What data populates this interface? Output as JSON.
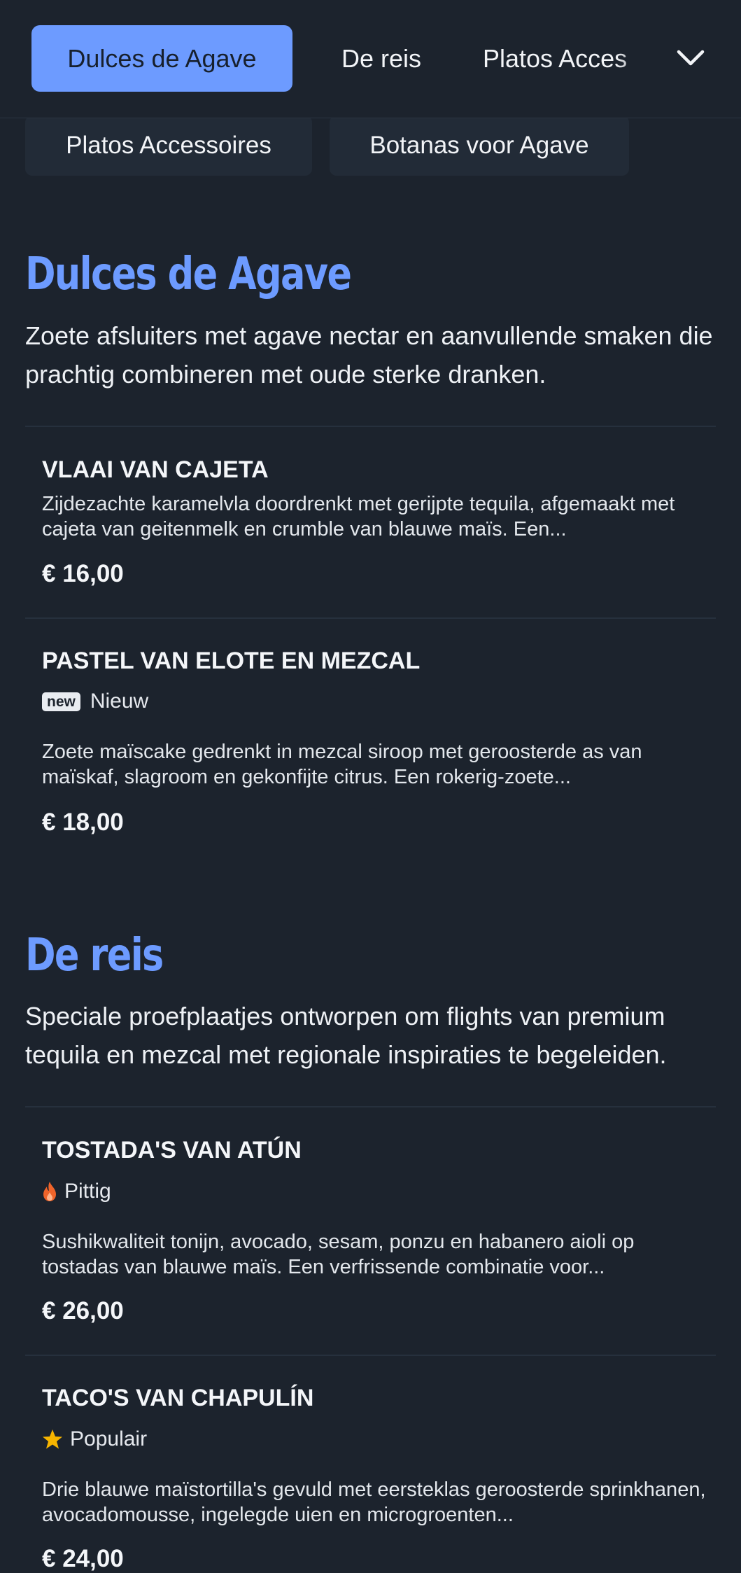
{
  "nav": {
    "tabs": [
      {
        "label": "Dulces de Agave",
        "active": true
      },
      {
        "label": "De reis",
        "active": false
      },
      {
        "label": "Platos Acces",
        "active": false
      }
    ],
    "more_icon": "chevron-down-icon",
    "overflow_chips": [
      "Platos Accessoires",
      "Botanas voor Agave"
    ]
  },
  "sections": [
    {
      "title": "Dulces de Agave",
      "description": "Zoete afsluiters met agave nectar en aanvullende smaken die prachtig combineren met oude sterke dranken.",
      "items": [
        {
          "name": "VLAAI VAN CAJETA",
          "description": "Zijdezachte karamelvla doordrenkt met gerijpte tequila, afgemaakt met cajeta van geitenmelk en crumble van blauwe maïs. Een...",
          "price": "€ 16,00"
        },
        {
          "name": "PASTEL VAN ELOTE EN MEZCAL",
          "badge": "new",
          "tag": "Nieuw",
          "description": "Zoete maïscake gedrenkt in mezcal siroop met geroosterde as van maïskaf, slagroom en gekonfijte citrus. Een rokerig-zoete...",
          "price": "€ 18,00"
        }
      ]
    },
    {
      "title": "De reis",
      "description": "Speciale proefplaatjes ontworpen om flights van premium tequila en mezcal met regionale inspiraties te begeleiden.",
      "items": [
        {
          "name": "TOSTADA'S VAN ATÚN",
          "tag_icon": "flame-icon",
          "tag": "Pittig",
          "description": "Sushikwaliteit tonijn, avocado, sesam, ponzu en habanero aioli op tostadas van blauwe maïs. Een verfrissende combinatie voor...",
          "price": "€ 26,00"
        },
        {
          "name": "TACO'S VAN CHAPULÍN",
          "tag_icon": "star-icon",
          "tag": "Populair",
          "description": "Drie blauwe maïstortilla's gevuld met eersteklas geroosterde sprinkhanen, avocadomousse, ingelegde uien en microgroenten...",
          "price": "€ 24,00"
        }
      ]
    }
  ],
  "colors": {
    "background": "#1c232d",
    "accent": "#6d9bff",
    "chip": "#222b37",
    "flame": "#f0642a",
    "star": "#f7b500"
  }
}
